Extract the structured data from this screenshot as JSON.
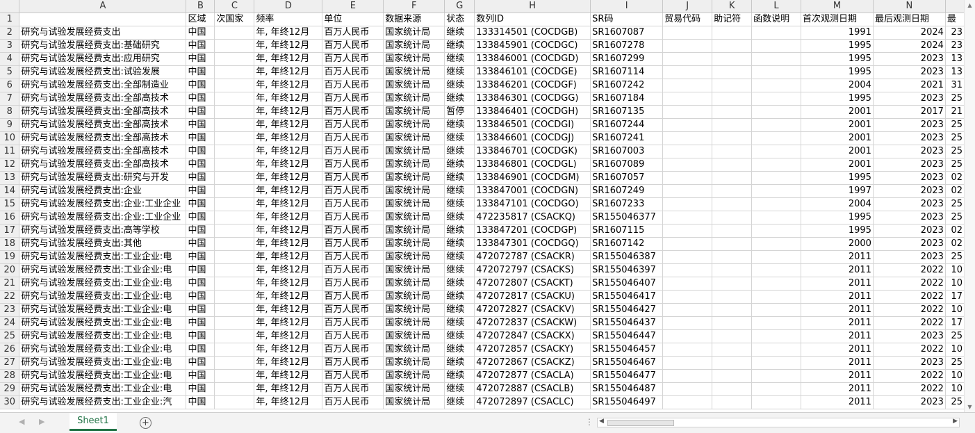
{
  "columns": [
    "A",
    "B",
    "C",
    "D",
    "E",
    "F",
    "G",
    "H",
    "I",
    "J",
    "K",
    "L",
    "M",
    "N",
    ""
  ],
  "header": [
    "",
    "区域",
    "次国家",
    "频率",
    "单位",
    "数据来源",
    "状态",
    "数列ID",
    "SR码",
    "贸易代码",
    "助记符",
    "函数说明",
    "首次观测日期",
    "最后观测日期",
    "最"
  ],
  "rows": [
    [
      "研究与试验发展经费支出",
      "中国",
      "",
      "年, 年终12月",
      "百万人民币",
      "国家统计局",
      "继续",
      "133314501 (COCDGB)",
      "SR1607087",
      "",
      "",
      "",
      "1991",
      "2024",
      "23"
    ],
    [
      "研究与试验发展经费支出:基础研究",
      "中国",
      "",
      "年, 年终12月",
      "百万人民币",
      "国家统计局",
      "继续",
      "133845901 (COCDGC)",
      "SR1607278",
      "",
      "",
      "",
      "1995",
      "2024",
      "23"
    ],
    [
      "研究与试验发展经费支出:应用研究",
      "中国",
      "",
      "年, 年终12月",
      "百万人民币",
      "国家统计局",
      "继续",
      "133846001 (COCDGD)",
      "SR1607299",
      "",
      "",
      "",
      "1995",
      "2023",
      "13"
    ],
    [
      "研究与试验发展经费支出:试验发展",
      "中国",
      "",
      "年, 年终12月",
      "百万人民币",
      "国家统计局",
      "继续",
      "133846101 (COCDGE)",
      "SR1607114",
      "",
      "",
      "",
      "1995",
      "2023",
      "13"
    ],
    [
      "研究与试验发展经费支出:全部制造业",
      "中国",
      "",
      "年, 年终12月",
      "百万人民币",
      "国家统计局",
      "继续",
      "133846201 (COCDGF)",
      "SR1607242",
      "",
      "",
      "",
      "2004",
      "2021",
      "31"
    ],
    [
      "研究与试验发展经费支出:全部高技术",
      "中国",
      "",
      "年, 年终12月",
      "百万人民币",
      "国家统计局",
      "继续",
      "133846301 (COCDGG)",
      "SR1607184",
      "",
      "",
      "",
      "1995",
      "2023",
      "25"
    ],
    [
      "研究与试验发展经费支出:全部高技术",
      "中国",
      "",
      "年, 年终12月",
      "百万人民币",
      "国家统计局",
      "暂停",
      "133846401 (COCDGH)",
      "SR1607135",
      "",
      "",
      "",
      "2001",
      "2017",
      "21"
    ],
    [
      "研究与试验发展经费支出:全部高技术",
      "中国",
      "",
      "年, 年终12月",
      "百万人民币",
      "国家统计局",
      "继续",
      "133846501 (COCDGI)",
      "SR1607244",
      "",
      "",
      "",
      "2001",
      "2023",
      "25"
    ],
    [
      "研究与试验发展经费支出:全部高技术",
      "中国",
      "",
      "年, 年终12月",
      "百万人民币",
      "国家统计局",
      "继续",
      "133846601 (COCDGJ)",
      "SR1607241",
      "",
      "",
      "",
      "2001",
      "2023",
      "25"
    ],
    [
      "研究与试验发展经费支出:全部高技术",
      "中国",
      "",
      "年, 年终12月",
      "百万人民币",
      "国家统计局",
      "继续",
      "133846701 (COCDGK)",
      "SR1607003",
      "",
      "",
      "",
      "2001",
      "2023",
      "25"
    ],
    [
      "研究与试验发展经费支出:全部高技术",
      "中国",
      "",
      "年, 年终12月",
      "百万人民币",
      "国家统计局",
      "继续",
      "133846801 (COCDGL)",
      "SR1607089",
      "",
      "",
      "",
      "2001",
      "2023",
      "25"
    ],
    [
      "研究与试验发展经费支出:研究与开发",
      "中国",
      "",
      "年, 年终12月",
      "百万人民币",
      "国家统计局",
      "继续",
      "133846901 (COCDGM)",
      "SR1607057",
      "",
      "",
      "",
      "1995",
      "2023",
      "02"
    ],
    [
      "研究与试验发展经费支出:企业",
      "中国",
      "",
      "年, 年终12月",
      "百万人民币",
      "国家统计局",
      "继续",
      "133847001 (COCDGN)",
      "SR1607249",
      "",
      "",
      "",
      "1997",
      "2023",
      "02"
    ],
    [
      "研究与试验发展经费支出:企业:工业企业",
      "中国",
      "",
      "年, 年终12月",
      "百万人民币",
      "国家统计局",
      "继续",
      "133847101 (COCDGO)",
      "SR1607233",
      "",
      "",
      "",
      "2004",
      "2023",
      "25"
    ],
    [
      "研究与试验发展经费支出:企业:工业企业",
      "中国",
      "",
      "年, 年终12月",
      "百万人民币",
      "国家统计局",
      "继续",
      "472235817 (CSACKQ)",
      "SR155046377",
      "",
      "",
      "",
      "1995",
      "2023",
      "25"
    ],
    [
      "研究与试验发展经费支出:高等学校",
      "中国",
      "",
      "年, 年终12月",
      "百万人民币",
      "国家统计局",
      "继续",
      "133847201 (COCDGP)",
      "SR1607115",
      "",
      "",
      "",
      "1995",
      "2023",
      "02"
    ],
    [
      "研究与试验发展经费支出:其他",
      "中国",
      "",
      "年, 年终12月",
      "百万人民币",
      "国家统计局",
      "继续",
      "133847301 (COCDGQ)",
      "SR1607142",
      "",
      "",
      "",
      "2000",
      "2023",
      "02"
    ],
    [
      "研究与试验发展经费支出:工业企业:电",
      "中国",
      "",
      "年, 年终12月",
      "百万人民币",
      "国家统计局",
      "继续",
      "472072787 (CSACKR)",
      "SR155046387",
      "",
      "",
      "",
      "2011",
      "2023",
      "25"
    ],
    [
      "研究与试验发展经费支出:工业企业:电",
      "中国",
      "",
      "年, 年终12月",
      "百万人民币",
      "国家统计局",
      "继续",
      "472072797 (CSACKS)",
      "SR155046397",
      "",
      "",
      "",
      "2011",
      "2022",
      "10"
    ],
    [
      "研究与试验发展经费支出:工业企业:电",
      "中国",
      "",
      "年, 年终12月",
      "百万人民币",
      "国家统计局",
      "继续",
      "472072807 (CSACKT)",
      "SR155046407",
      "",
      "",
      "",
      "2011",
      "2022",
      "10"
    ],
    [
      "研究与试验发展经费支出:工业企业:电",
      "中国",
      "",
      "年, 年终12月",
      "百万人民币",
      "国家统计局",
      "继续",
      "472072817 (CSACKU)",
      "SR155046417",
      "",
      "",
      "",
      "2011",
      "2022",
      "17"
    ],
    [
      "研究与试验发展经费支出:工业企业:电",
      "中国",
      "",
      "年, 年终12月",
      "百万人民币",
      "国家统计局",
      "继续",
      "472072827 (CSACKV)",
      "SR155046427",
      "",
      "",
      "",
      "2011",
      "2022",
      "10"
    ],
    [
      "研究与试验发展经费支出:工业企业:电",
      "中国",
      "",
      "年, 年终12月",
      "百万人民币",
      "国家统计局",
      "继续",
      "472072837 (CSACKW)",
      "SR155046437",
      "",
      "",
      "",
      "2011",
      "2022",
      "17"
    ],
    [
      "研究与试验发展经费支出:工业企业:电",
      "中国",
      "",
      "年, 年终12月",
      "百万人民币",
      "国家统计局",
      "继续",
      "472072847 (CSACKX)",
      "SR155046447",
      "",
      "",
      "",
      "2011",
      "2023",
      "25"
    ],
    [
      "研究与试验发展经费支出:工业企业:电",
      "中国",
      "",
      "年, 年终12月",
      "百万人民币",
      "国家统计局",
      "继续",
      "472072857 (CSACKY)",
      "SR155046457",
      "",
      "",
      "",
      "2011",
      "2022",
      "10"
    ],
    [
      "研究与试验发展经费支出:工业企业:电",
      "中国",
      "",
      "年, 年终12月",
      "百万人民币",
      "国家统计局",
      "继续",
      "472072867 (CSACKZ)",
      "SR155046467",
      "",
      "",
      "",
      "2011",
      "2023",
      "25"
    ],
    [
      "研究与试验发展经费支出:工业企业:电",
      "中国",
      "",
      "年, 年终12月",
      "百万人民币",
      "国家统计局",
      "继续",
      "472072877 (CSACLA)",
      "SR155046477",
      "",
      "",
      "",
      "2011",
      "2022",
      "10"
    ],
    [
      "研究与试验发展经费支出:工业企业:电",
      "中国",
      "",
      "年, 年终12月",
      "百万人民币",
      "国家统计局",
      "继续",
      "472072887 (CSACLB)",
      "SR155046487",
      "",
      "",
      "",
      "2011",
      "2022",
      "10"
    ],
    [
      "研究与试验发展经费支出:工业企业:汽",
      "中国",
      "",
      "年, 年终12月",
      "百万人民币",
      "国家统计局",
      "继续",
      "472072897 (CSACLC)",
      "SR155046497",
      "",
      "",
      "",
      "2011",
      "2023",
      "25"
    ]
  ],
  "sheet_tab": "Sheet1",
  "colors": {
    "accent": "#217346",
    "header_bg": "#efefef",
    "grid": "#d4d4d4"
  },
  "icons": {
    "add_sheet": "plus-circle-icon",
    "scroll_left": "triangle-left-icon",
    "scroll_right": "triangle-right-icon",
    "scroll_up": "triangle-up-icon",
    "scroll_down": "triangle-down-icon"
  }
}
